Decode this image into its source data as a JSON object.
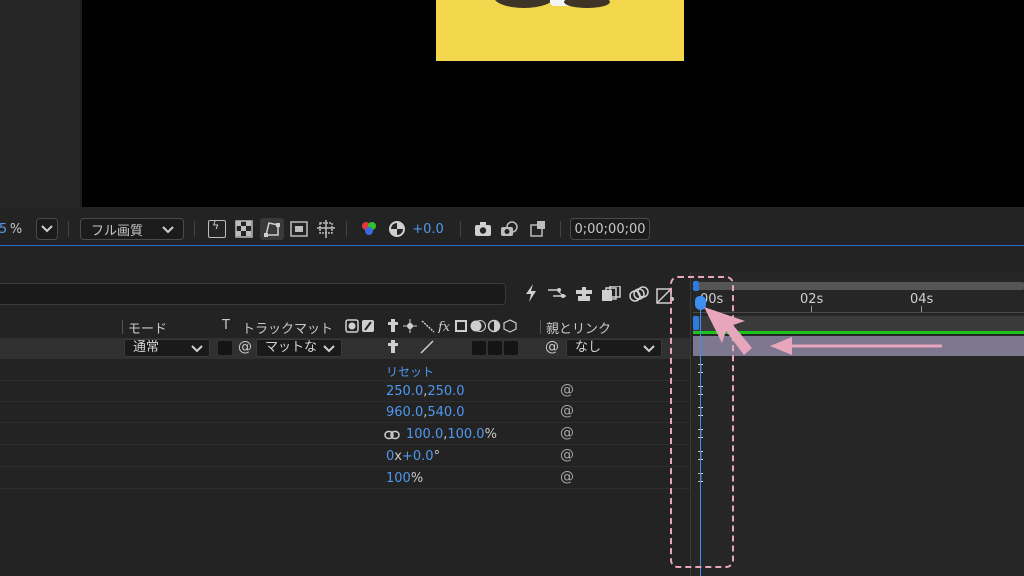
{
  "viewer": {
    "zoom_suffix": "%",
    "resolution": "フル画質",
    "exposure": "+0.0",
    "timecode": "0;00;00;00"
  },
  "timeline": {
    "ruler": {
      "t0": "00s",
      "t2": "02s",
      "t4": "04s"
    },
    "columns": {
      "mode": "モード",
      "t": "T",
      "track_matte": "トラックマット",
      "parent": "親とリンク"
    },
    "layer": {
      "mode": "通常",
      "track_matte": "マットな",
      "parent": "なし"
    },
    "properties": {
      "reset": "リセット",
      "anchor": {
        "a": "250.0",
        "b": "250.0"
      },
      "position": {
        "a": "960.0",
        "b": "540.0"
      },
      "scale": {
        "a": "100.0",
        "b": "100.0",
        "unit": "%"
      },
      "rotation": {
        "turns": "0",
        "x": "x",
        "deg": "+0.0",
        "unit": "°"
      },
      "opacity": {
        "value": "100",
        "unit": "%"
      }
    }
  },
  "colors": {
    "accent_blue": "#3d8ff0",
    "highlight_pink": "#e8a6bd",
    "layer_bar": "#7d7790",
    "green_bar": "#1ec41e"
  },
  "icons": [
    "lightning-icon",
    "graph-icon",
    "solo-icon",
    "motion-blur-icon",
    "frame-blend-icon",
    "draft-3d-icon",
    "camera-icon",
    "spiral-icon",
    "link-icon",
    "chevron-down-icon"
  ]
}
